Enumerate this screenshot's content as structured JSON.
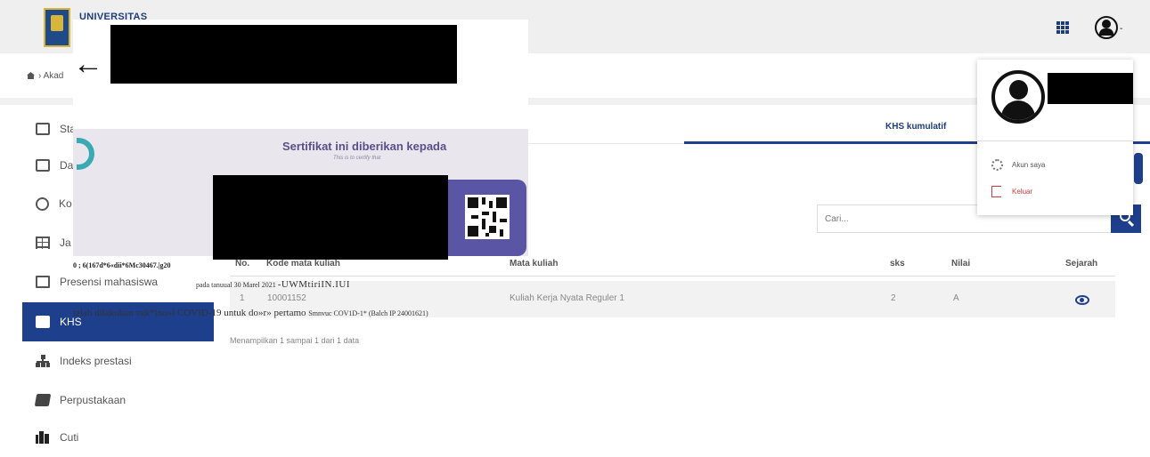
{
  "header": {
    "brand": "UNIVERSITAS",
    "apps_icon": "apps-grid-icon",
    "user_icon": "user-circle-icon",
    "caret": "-"
  },
  "breadcrumb": {
    "text": "Akad"
  },
  "sidebar": {
    "items": [
      {
        "label": "Sta",
        "icon": "dashboard-icon"
      },
      {
        "label": "Da",
        "icon": "id-card-icon"
      },
      {
        "label": "Ko",
        "icon": "globe-icon"
      },
      {
        "label": "Ja",
        "icon": "table-icon"
      },
      {
        "label": "Presensi mahasiswa",
        "icon": "edit-icon"
      },
      {
        "label": "KHS",
        "icon": "id-card-icon",
        "active": true
      },
      {
        "label": "Indeks prestasi",
        "icon": "sitemap-icon"
      },
      {
        "label": "Perpustakaan",
        "icon": "book-icon"
      },
      {
        "label": "Cuti",
        "icon": "pause-icon"
      }
    ]
  },
  "main": {
    "tab_active": "KHS kumulatif",
    "search_placeholder": "Cari...",
    "table": {
      "headers": [
        "No.",
        "Kode mata kuliah",
        "Mata kuliah",
        "sks",
        "Nilai",
        "Sejarah"
      ],
      "rows": [
        {
          "no": "1",
          "kode": "10001152",
          "mata_kuliah": "Kuliah Kerja Nyata Reguler 1",
          "sks": "2",
          "nilai": "A"
        }
      ]
    },
    "info": "Menampilkan 1 sampai 1 dari 1 data"
  },
  "certificate": {
    "title": "Sertifikat ini diberikan kepada",
    "subtitle": "This is to certify that",
    "line1": "0 ; 6(167d*6«dii*6Mc30467.|g20",
    "line2_small": "pada tanuual 30 Marel 2021 ",
    "line2_big": "-UWMtiriIN.IUI",
    "line3_prefix": "telah dilakukan vak*ino»l COVID-19 untuk do»r» pertamo ",
    "line3_small": "Smnvuc COV1D-1* (Balch IP 24001621)"
  },
  "dropdown": {
    "account_label": "Akun saya",
    "logout_label": "Keluar"
  }
}
